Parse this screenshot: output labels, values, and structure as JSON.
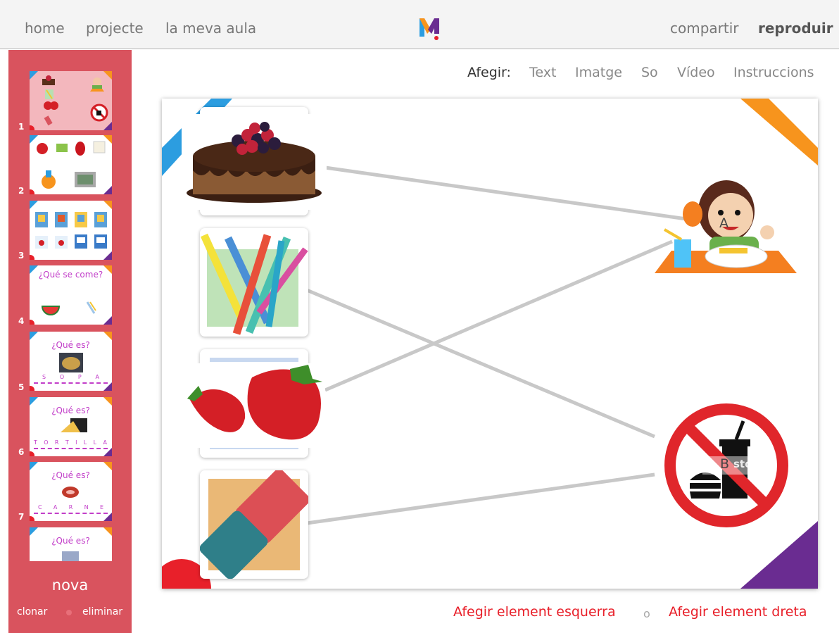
{
  "nav": {
    "left": [
      "home",
      "projecte",
      "la meva aula"
    ],
    "right": [
      "compartir",
      "reproduir"
    ]
  },
  "logo": {
    "icon": "logo-m-icon",
    "colors": [
      "#2c9de0",
      "#f7941d",
      "#6a2c91",
      "#e8202a"
    ]
  },
  "toolbar": {
    "label": "Afegir:",
    "items": [
      "Text",
      "Imatge",
      "So",
      "Vídeo",
      "Instruccions"
    ]
  },
  "sidebar": {
    "slides": [
      {
        "number": "1",
        "title": "",
        "icons": [
          "cake-icon",
          "boy-eating-icon",
          "strawberry-icon",
          "no-food-icon"
        ]
      },
      {
        "number": "2",
        "title": "",
        "icons": [
          "apple-icon",
          "tape-icon",
          "pepper-icon",
          "paper-icon",
          "bottle-icon",
          "lunchbox-icon"
        ]
      },
      {
        "number": "3",
        "title": "",
        "icons": [
          "juice-box-icon",
          "juice-box-icon",
          "juice-box-icon",
          "juice-box-icon",
          "milk-carton-icon",
          "milk-carton-icon",
          "milk-carton-icon",
          "milk-carton-icon"
        ]
      },
      {
        "number": "4",
        "title": "¿Qué se come?",
        "icons": [
          "watermelon-icon",
          "paperclip-icon"
        ]
      },
      {
        "number": "5",
        "title": "¿Qué es?",
        "letters": [
          "S",
          "O",
          "P",
          "A"
        ],
        "icons": [
          "soup-icon"
        ]
      },
      {
        "number": "6",
        "title": "¿Qué es?",
        "letters": [
          "T",
          "O",
          "R",
          "T",
          "I",
          "L",
          "L",
          "A"
        ],
        "icons": [
          "tortilla-icon"
        ]
      },
      {
        "number": "7",
        "title": "¿Qué es?",
        "letters": [
          "C",
          "A",
          "R",
          "N",
          "E"
        ],
        "icons": [
          "meat-icon"
        ]
      },
      {
        "number": "",
        "title": "¿Qué es?",
        "icons": [
          "food-icon"
        ]
      }
    ],
    "nova": "nova",
    "clone": "clonar",
    "delete": "eliminar"
  },
  "canvas": {
    "left_items": [
      "cake-image",
      "colored-pencils-image",
      "strawberries-image",
      "eraser-image"
    ],
    "right_items": [
      {
        "label": "A",
        "image": "boy-eating-image"
      },
      {
        "label": "B",
        "image": "no-food-sign-image",
        "watermark": "stock"
      }
    ]
  },
  "bottom": {
    "add_left": "Afegir element esquerra",
    "separator": "o",
    "add_right": "Afegir element dreta"
  }
}
